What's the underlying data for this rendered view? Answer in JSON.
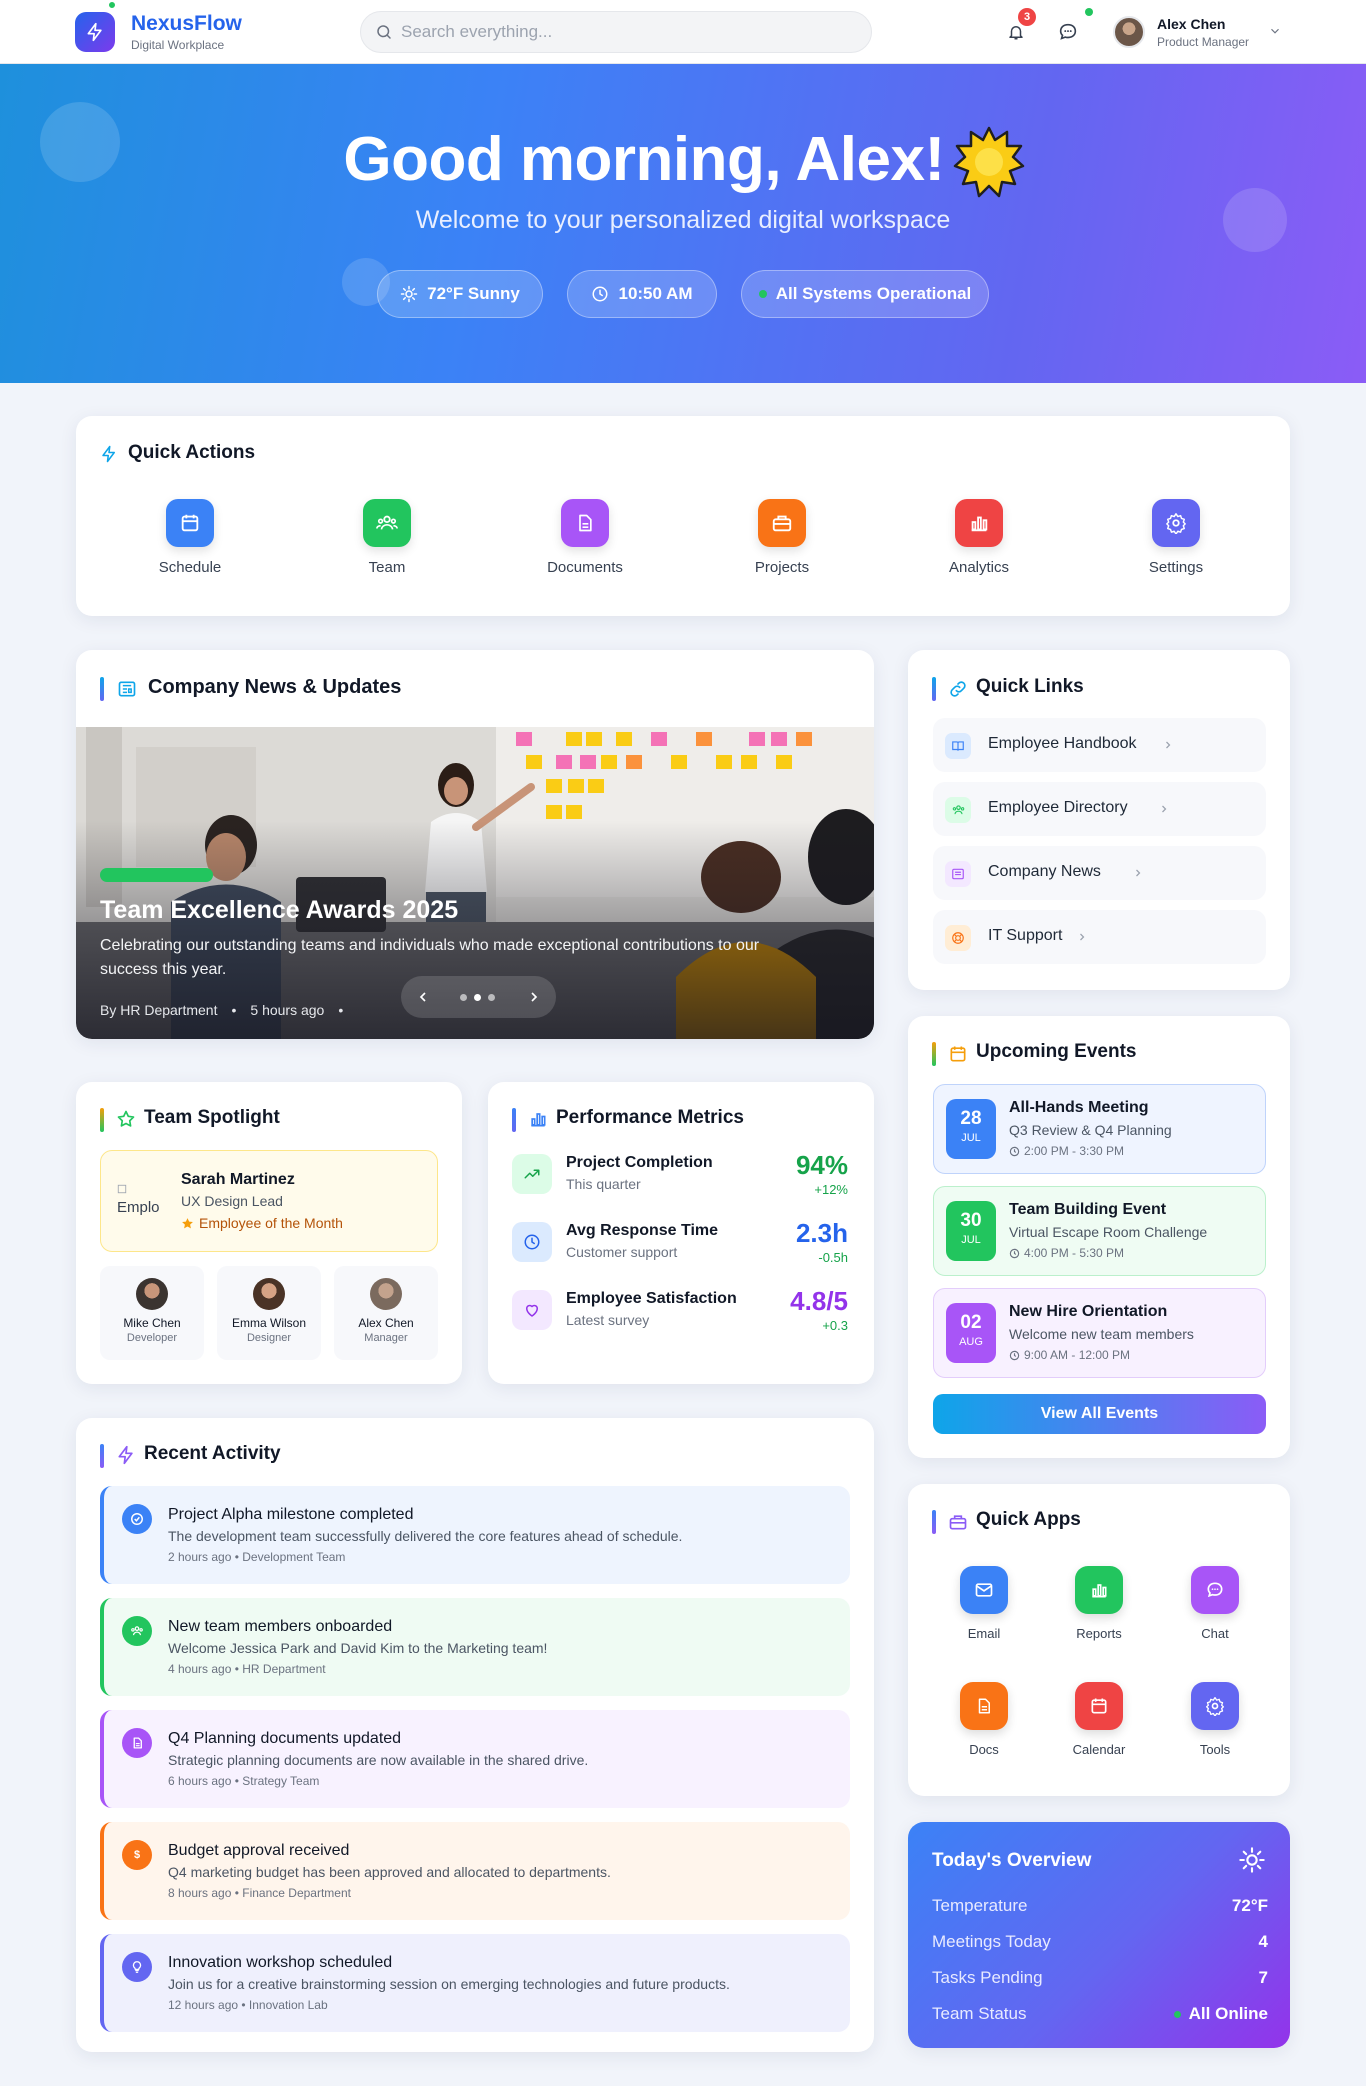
{
  "header": {
    "brand": "NexusFlow",
    "brand_sub": "Digital Workplace",
    "search_placeholder": "Search everything...",
    "notification_count": "3",
    "user_name": "Alex Chen",
    "user_role": "Product Manager"
  },
  "hero": {
    "greeting": "Good morning, Alex!",
    "subtitle": "Welcome to your personalized digital workspace",
    "weather": "72°F Sunny",
    "time": "10:50 AM",
    "status": "All Systems Operational"
  },
  "quick_actions": {
    "title": "Quick Actions",
    "items": [
      {
        "label": "Schedule",
        "icon": "calendar-icon",
        "color": "#3b82f6"
      },
      {
        "label": "Team",
        "icon": "users-icon",
        "color": "#22c55e"
      },
      {
        "label": "Documents",
        "icon": "document-icon",
        "color": "#a855f7"
      },
      {
        "label": "Projects",
        "icon": "briefcase-icon",
        "color": "#f97316"
      },
      {
        "label": "Analytics",
        "icon": "bar-chart-icon",
        "color": "#ef4444"
      },
      {
        "label": "Settings",
        "icon": "gear-icon",
        "color": "#6366f1"
      }
    ]
  },
  "news": {
    "title": "Company News & Updates",
    "headline": "Team Excellence Awards 2025",
    "description": "Celebrating our outstanding teams and individuals who made exceptional contributions to our success this year.",
    "author": "By HR Department",
    "time": "5 hours ago"
  },
  "quick_links": {
    "title": "Quick Links",
    "items": [
      {
        "label": "Employee Handbook",
        "icon": "book-icon",
        "color": "#3b82f6",
        "bg": "#dbeafe"
      },
      {
        "label": "Employee Directory",
        "icon": "users-icon",
        "color": "#22c55e",
        "bg": "#dcfce7"
      },
      {
        "label": "Company News",
        "icon": "newspaper-icon",
        "color": "#a855f7",
        "bg": "#f3e8ff"
      },
      {
        "label": "IT Support",
        "icon": "lifebuoy-icon",
        "color": "#f97316",
        "bg": "#ffedd5"
      }
    ]
  },
  "events": {
    "title": "Upcoming Events",
    "button": "View All Events",
    "items": [
      {
        "day": "28",
        "month": "JUL",
        "title": "All-Hands Meeting",
        "subtitle": "Q3 Review & Q4 Planning",
        "time": "2:00 PM - 3:30 PM",
        "color": "#3b82f6",
        "bg": "#eff4ff",
        "border": "#bfd3fb"
      },
      {
        "day": "30",
        "month": "JUL",
        "title": "Team Building Event",
        "subtitle": "Virtual Escape Room Challenge",
        "time": "4:00 PM - 5:30 PM",
        "color": "#22c55e",
        "bg": "#effcf3",
        "border": "#bbf0cc"
      },
      {
        "day": "02",
        "month": "AUG",
        "title": "New Hire Orientation",
        "subtitle": "Welcome new team members",
        "time": "9:00 AM - 12:00 PM",
        "color": "#a855f7",
        "bg": "#f8f1ff",
        "border": "#e3cdfb"
      }
    ]
  },
  "spotlight": {
    "title": "Team Spotlight",
    "featured_name": "Sarah Martinez",
    "featured_role": "UX Design Lead",
    "featured_award": "Employee of the Month",
    "featured_img_alt": "Emplo",
    "members": [
      {
        "name": "Mike Chen",
        "role": "Developer"
      },
      {
        "name": "Emma Wilson",
        "role": "Designer"
      },
      {
        "name": "Alex Chen",
        "role": "Manager"
      }
    ]
  },
  "metrics": {
    "title": "Performance Metrics",
    "items": [
      {
        "name": "Project Completion",
        "sub": "This quarter",
        "value": "94%",
        "delta": "+12%",
        "color": "#16a34a",
        "bg": "#dcfce7",
        "icon": "trend-up-icon"
      },
      {
        "name": "Avg Response Time",
        "sub": "Customer support",
        "value": "2.3h",
        "delta": "-0.5h",
        "color": "#2563eb",
        "bg": "#dbeafe",
        "icon": "clock-icon"
      },
      {
        "name": "Employee Satisfaction",
        "sub": "Latest survey",
        "value": "4.8/5",
        "delta": "+0.3",
        "color": "#9333ea",
        "bg": "#f3e8ff",
        "icon": "heart-icon"
      }
    ]
  },
  "activity": {
    "title": "Recent Activity",
    "items": [
      {
        "title": "Project Alpha milestone completed",
        "desc": "The development team successfully delivered the core features ahead of schedule.",
        "meta": "2 hours ago • Development Team",
        "color": "#3b82f6",
        "bg": "#eef4fe",
        "icon": "check-circle-icon"
      },
      {
        "title": "New team members onboarded",
        "desc": "Welcome Jessica Park and David Kim to the Marketing team!",
        "meta": "4 hours ago • HR Department",
        "color": "#22c55e",
        "bg": "#effbf3",
        "icon": "users-icon"
      },
      {
        "title": "Q4 Planning documents updated",
        "desc": "Strategic planning documents are now available in the shared drive.",
        "meta": "6 hours ago • Strategy Team",
        "color": "#a855f7",
        "bg": "#f8f2ff",
        "icon": "document-icon"
      },
      {
        "title": "Budget approval received",
        "desc": "Q4 marketing budget has been approved and allocated to departments.",
        "meta": "8 hours ago • Finance Department",
        "color": "#f97316",
        "bg": "#fff5ec",
        "icon": "dollar-icon"
      },
      {
        "title": "Innovation workshop scheduled",
        "desc": "Join us for a creative brainstorming session on emerging technologies and future products.",
        "meta": "12 hours ago • Innovation Lab",
        "color": "#6366f1",
        "bg": "#eff0fd",
        "icon": "lightbulb-icon"
      }
    ]
  },
  "quick_apps": {
    "title": "Quick Apps",
    "items": [
      {
        "label": "Email",
        "icon": "mail-icon",
        "color": "#3b82f6"
      },
      {
        "label": "Reports",
        "icon": "bar-chart-icon",
        "color": "#22c55e"
      },
      {
        "label": "Chat",
        "icon": "chat-icon",
        "color": "#a855f7"
      },
      {
        "label": "Docs",
        "icon": "document-icon",
        "color": "#f97316"
      },
      {
        "label": "Calendar",
        "icon": "calendar-icon",
        "color": "#ef4444"
      },
      {
        "label": "Tools",
        "icon": "gear-icon",
        "color": "#6366f1"
      }
    ]
  },
  "overview": {
    "title": "Today's Overview",
    "rows": [
      {
        "label": "Temperature",
        "value": "72°F"
      },
      {
        "label": "Meetings Today",
        "value": "4"
      },
      {
        "label": "Tasks Pending",
        "value": "7"
      },
      {
        "label": "Team Status",
        "value": "All Online"
      }
    ]
  }
}
